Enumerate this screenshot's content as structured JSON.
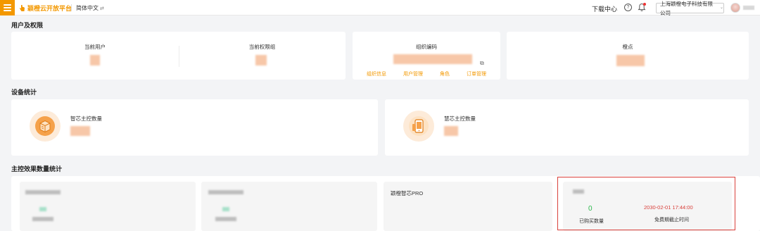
{
  "header": {
    "logo_text": "颖橙云开放平台",
    "language": "简体中文",
    "download_center": "下载中心",
    "company": "上海颖橙电子科技有限公司"
  },
  "users": {
    "title": "用户及权限",
    "current_user_label": "当前用户",
    "current_group_label": "当前权限组",
    "org_code_label": "组织编码",
    "links": [
      "组织信息",
      "用户管理",
      "角色",
      "订单管理"
    ],
    "points_label": "橙点"
  },
  "devices": {
    "title": "设备统计",
    "smart_core_label": "智芯主控数量",
    "color_core_label": "慧芯主控数量"
  },
  "effects": {
    "title": "主控效果数量统计",
    "card3_name": "颖橙智芯PRO",
    "purchased_count": "0",
    "purchased_label": "已购买数量",
    "expiry_date": "2030-02-01 17:44:00",
    "expiry_label": "免费期截止时间"
  }
}
